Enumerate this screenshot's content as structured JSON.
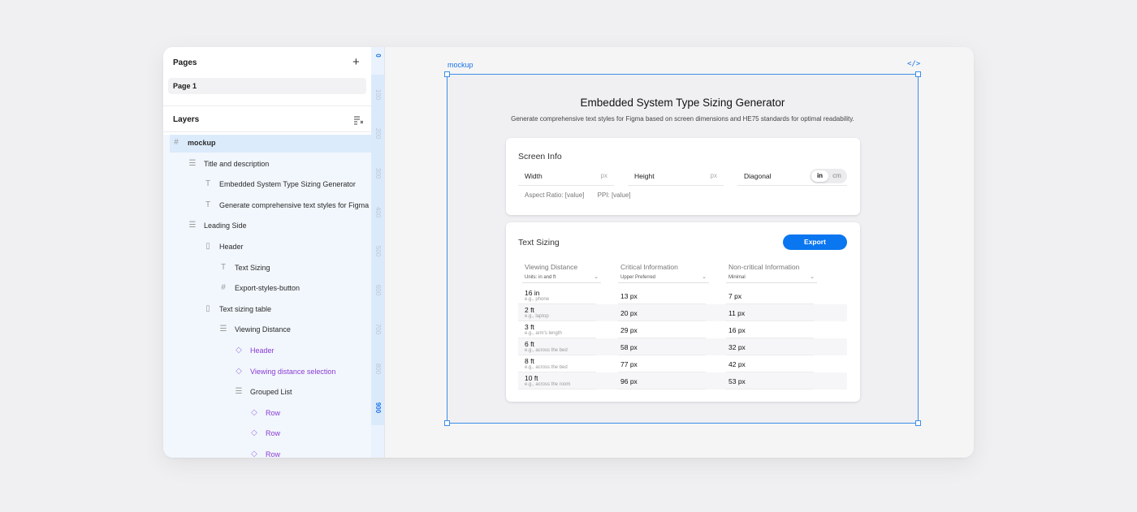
{
  "pages_panel": {
    "title": "Pages",
    "add_icon": "plus-icon",
    "current_page": "Page 1"
  },
  "layers_panel": {
    "title": "Layers",
    "items": [
      {
        "label": "mockup",
        "icon": "frame-icon",
        "selected": true
      },
      {
        "label": "Title and description",
        "icon": "auto-layout-icon"
      },
      {
        "label": "Embedded System Type Sizing Generator",
        "icon": "text-icon"
      },
      {
        "label": "Generate comprehensive text styles for Figma based on screen dimensions and HE75 standards for optimal readability.",
        "icon": "text-icon"
      },
      {
        "label": "Leading Side",
        "icon": "auto-layout-icon"
      },
      {
        "label": "Header",
        "icon": "horizontal-layout-icon"
      },
      {
        "label": "Text Sizing",
        "icon": "text-icon"
      },
      {
        "label": "Export-styles-button",
        "icon": "frame-icon"
      },
      {
        "label": "Text sizing table",
        "icon": "horizontal-layout-icon"
      },
      {
        "label": "Viewing Distance",
        "icon": "auto-layout-icon"
      },
      {
        "label": "Header",
        "icon": "component-icon",
        "component": true
      },
      {
        "label": "Viewing distance selection",
        "icon": "component-icon",
        "component": true
      },
      {
        "label": "Grouped List",
        "icon": "auto-layout-icon"
      },
      {
        "label": "Row",
        "icon": "component-icon",
        "component": true
      },
      {
        "label": "Row",
        "icon": "component-icon",
        "component": true
      },
      {
        "label": "Row",
        "icon": "component-icon",
        "component": true
      }
    ]
  },
  "ruler": {
    "ticks": [
      "0",
      "100",
      "200",
      "300",
      "400",
      "500",
      "600",
      "700",
      "800",
      "900"
    ],
    "active": [
      "0",
      "900"
    ]
  },
  "canvas": {
    "frame_name": "mockup",
    "code_icon": "code-icon",
    "title": "Embedded System Type Sizing Generator",
    "description": "Generate comprehensive text styles for Figma based on screen dimensions and HE75 standards for optimal readability.",
    "screen_info": {
      "title": "Screen Info",
      "width_label": "Width",
      "width_unit": "px",
      "height_label": "Height",
      "height_unit": "px",
      "diagonal_label": "Diagonal",
      "unit_in": "in",
      "unit_cm": "cm",
      "unit_selected": "in",
      "aspect_ratio": "Aspect Ratio:  [value]",
      "ppi": "PPI:  [value]"
    },
    "text_sizing": {
      "title": "Text Sizing",
      "export_label": "Export",
      "columns": [
        "Viewing Distance",
        "Critical Information",
        "Non-critical Information"
      ],
      "selects": [
        "Units: in and ft",
        "Upper Preferred",
        "Minimal"
      ],
      "rows": [
        {
          "distance": "16 in",
          "example": "e.g., phone",
          "critical": "13 px",
          "noncritical": "7 px"
        },
        {
          "distance": "2 ft",
          "example": "e.g., laptop",
          "critical": "20 px",
          "noncritical": "11 px"
        },
        {
          "distance": "3 ft",
          "example": "e.g., arm's length",
          "critical": "29 px",
          "noncritical": "16 px"
        },
        {
          "distance": "6 ft",
          "example": "e.g., across the bed",
          "critical": "58 px",
          "noncritical": "32 px"
        },
        {
          "distance": "8 ft",
          "example": "e.g., across the bed",
          "critical": "77 px",
          "noncritical": "42 px"
        },
        {
          "distance": "10 ft",
          "example": "e.g., across the room",
          "critical": "96 px",
          "noncritical": "53 px"
        }
      ]
    }
  },
  "colors": {
    "accent": "#0a76f0",
    "selection": "#3b8ee8",
    "component": "#8a3ad4"
  }
}
